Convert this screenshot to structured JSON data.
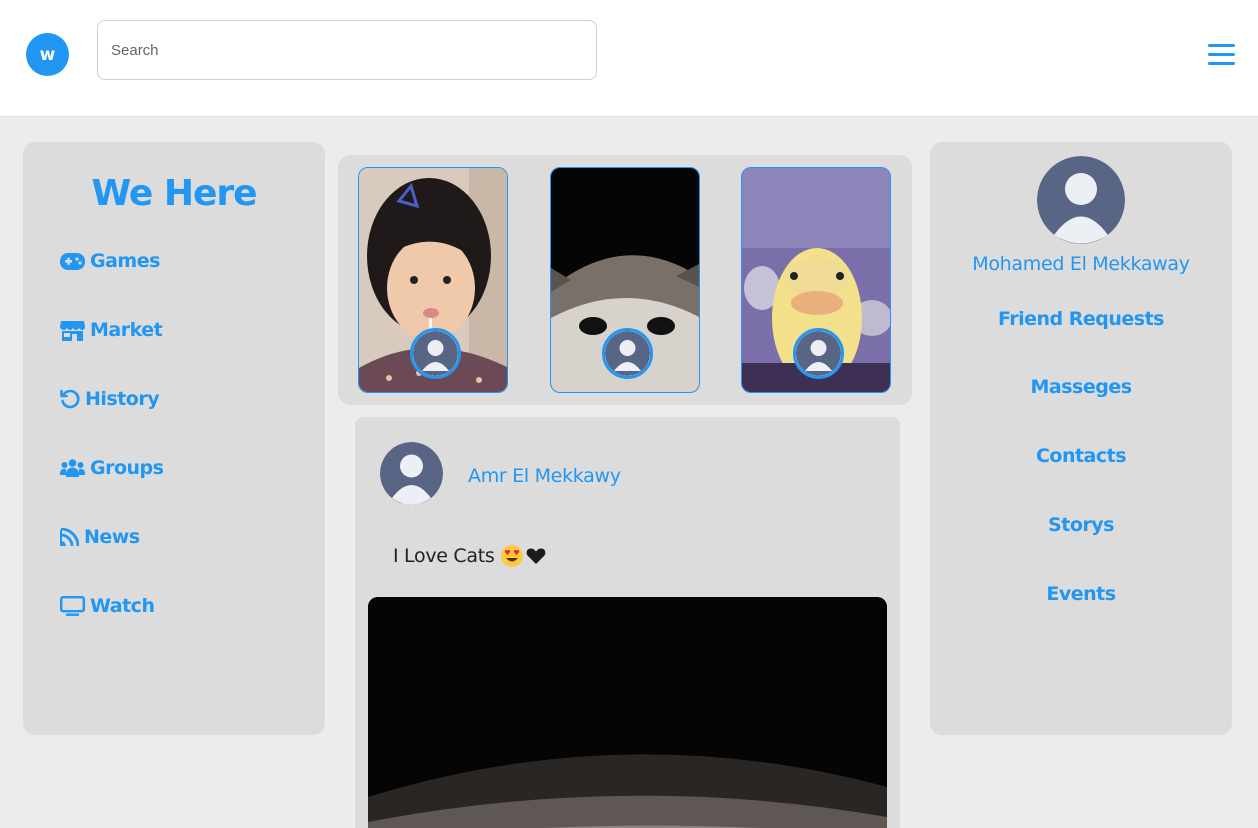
{
  "header": {
    "logo_letter": "w",
    "search_placeholder": "Search"
  },
  "sidebar": {
    "brand": "We Here",
    "items": [
      {
        "label": "Games",
        "icon": "gamepad-icon"
      },
      {
        "label": "Market",
        "icon": "store-icon"
      },
      {
        "label": "History",
        "icon": "history-icon"
      },
      {
        "label": "Groups",
        "icon": "users-icon"
      },
      {
        "label": "News",
        "icon": "rss-icon"
      },
      {
        "label": "Watch",
        "icon": "tv-icon"
      }
    ]
  },
  "stories": [
    {
      "subject": "child",
      "avatar": "user-avatar"
    },
    {
      "subject": "cat",
      "avatar": "user-avatar"
    },
    {
      "subject": "duckling",
      "avatar": "user-avatar"
    }
  ],
  "post": {
    "author": "Amr El Mekkawy",
    "text": "I Love Cats",
    "emojis": [
      "heart-eyes-emoji",
      "black-heart-emoji"
    ]
  },
  "profile": {
    "name": "Mohamed El Mekkaway",
    "links": [
      "Friend Requests",
      "Masseges",
      "Contacts",
      "Storys",
      "Events"
    ]
  },
  "colors": {
    "accent": "#2196f3",
    "panel": "#dcdcdc",
    "background": "#ececec",
    "avatar": "#596585"
  }
}
